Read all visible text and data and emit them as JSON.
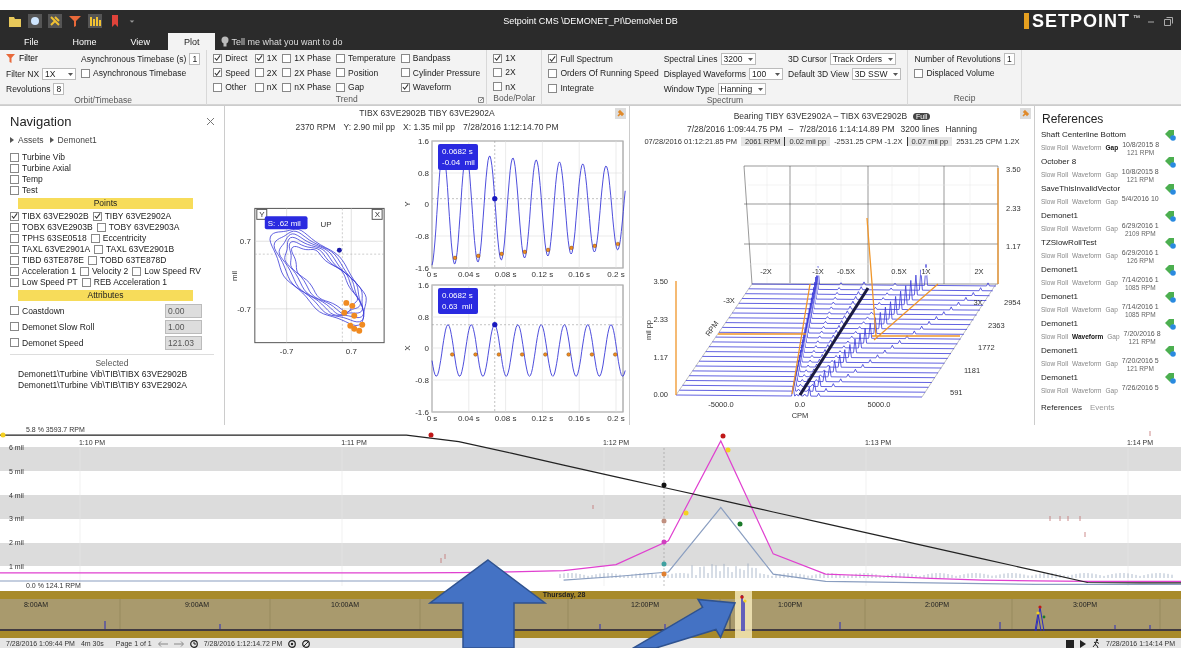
{
  "window": {
    "title": "Setpoint CMS \\DEMONET_PI\\DemoNet DB",
    "logo": "SETPOINT",
    "logo_mark": "™"
  },
  "ribbon_tabs": [
    {
      "label": "File",
      "selected": false
    },
    {
      "label": "Home",
      "selected": false
    },
    {
      "label": "View",
      "selected": false
    },
    {
      "label": "Plot",
      "selected": true
    }
  ],
  "tell_me": {
    "placeholder": "Tell me what you want to do"
  },
  "ribbon_groups": [
    {
      "title": "Orbit/Timebase",
      "launcher": false,
      "rows": [
        [
          {
            "kind": "filter",
            "label": "Filter"
          },
          {
            "kind": "number",
            "label": "Asynchronous Timebase (s)",
            "value": "1"
          }
        ],
        [
          {
            "kind": "dropdown",
            "label": "Filter NX",
            "value": "1X"
          },
          {
            "kind": "checkbox",
            "label": "Asynchronous Timebase",
            "checked": false
          }
        ],
        [
          {
            "kind": "number",
            "label": "Revolutions",
            "value": "8"
          }
        ]
      ]
    },
    {
      "title": "Trend",
      "launcher": true,
      "rows": [
        [
          {
            "kind": "checkbox",
            "label": "Direct",
            "checked": true
          },
          {
            "kind": "checkbox",
            "label": "1X",
            "checked": true
          },
          {
            "kind": "checkbox",
            "label": "1X Phase",
            "checked": false
          },
          {
            "kind": "checkbox",
            "label": "Temperature",
            "checked": false
          },
          {
            "kind": "checkbox",
            "label": "Bandpass",
            "checked": false
          }
        ],
        [
          {
            "kind": "checkbox",
            "label": "Speed",
            "checked": true
          },
          {
            "kind": "checkbox",
            "label": "2X",
            "checked": false
          },
          {
            "kind": "checkbox",
            "label": "2X Phase",
            "checked": false
          },
          {
            "kind": "checkbox",
            "label": "Position",
            "checked": false
          },
          {
            "kind": "checkbox",
            "label": "Cylinder Pressure",
            "checked": false
          }
        ],
        [
          {
            "kind": "checkbox",
            "label": "Other",
            "checked": false
          },
          {
            "kind": "checkbox",
            "label": "nX",
            "checked": false
          },
          {
            "kind": "checkbox",
            "label": "nX Phase",
            "checked": false
          },
          {
            "kind": "checkbox",
            "label": "Gap",
            "checked": false
          },
          {
            "kind": "checkbox",
            "label": "Waveform",
            "checked": true
          }
        ]
      ]
    },
    {
      "title": "Bode/Polar",
      "launcher": false,
      "rows": [
        [
          {
            "kind": "checkbox",
            "label": "1X",
            "checked": true
          }
        ],
        [
          {
            "kind": "checkbox",
            "label": "2X",
            "checked": false
          }
        ],
        [
          {
            "kind": "checkbox",
            "label": "nX",
            "checked": false
          }
        ]
      ]
    },
    {
      "title": "Spectrum",
      "launcher": false,
      "rows": [
        [
          {
            "kind": "checkbox",
            "label": "Full Spectrum",
            "checked": true
          },
          {
            "kind": "dropdown",
            "label": "Spectral Lines",
            "value": "3200"
          },
          {
            "kind": "dropdown",
            "label": "3D Cursor",
            "value": "Track Orders"
          }
        ],
        [
          {
            "kind": "checkbox",
            "label": "Orders Of Running Speed",
            "checked": false
          },
          {
            "kind": "dropdown",
            "label": "Displayed Waveforms",
            "value": "100"
          },
          {
            "kind": "dropdown",
            "label": "Default 3D View",
            "value": "3D SSW"
          }
        ],
        [
          {
            "kind": "checkbox",
            "label": "Integrate",
            "checked": false
          },
          {
            "kind": "dropdown",
            "label": "Window Type",
            "value": "Hanning"
          }
        ]
      ]
    },
    {
      "title": "Recip",
      "launcher": false,
      "rows": [
        [
          {
            "kind": "number",
            "label": "Number of Revolutions",
            "value": "1"
          }
        ],
        [
          {
            "kind": "checkbox",
            "label": "Displaced Volume",
            "checked": false
          }
        ]
      ]
    }
  ],
  "navigation": {
    "title": "Navigation",
    "breadcrumb": [
      "Assets",
      "Demonet1"
    ],
    "groups": [
      {
        "label": "Turbine Vib",
        "checked": false
      },
      {
        "label": "Turbine Axial",
        "checked": false
      },
      {
        "label": "Temp",
        "checked": false
      },
      {
        "label": "Test",
        "checked": false
      }
    ],
    "points_header": "Points",
    "points": [
      {
        "label": "TIBX 63VE2902B",
        "checked": true
      },
      {
        "label": "TIBY 63VE2902A",
        "checked": true
      },
      {
        "label": "TOBX 63VE2903B",
        "checked": false
      },
      {
        "label": "TOBY 63VE2903A",
        "checked": false
      },
      {
        "label": "TPHS 63SE0518",
        "checked": false
      },
      {
        "label": "Eccentricity",
        "checked": false
      },
      {
        "label": "TAXL 63VE2901A",
        "checked": false
      },
      {
        "label": "TAXL 63VE2901B",
        "checked": false
      },
      {
        "label": "TIBD 63TE878E",
        "checked": false
      },
      {
        "label": "TOBD 63TE878D",
        "checked": false
      },
      {
        "label": "Acceleration 1",
        "checked": false
      },
      {
        "label": "Velocity 2",
        "checked": false
      },
      {
        "label": "Low Speed RV",
        "checked": false
      },
      {
        "label": "Low Speed PT",
        "checked": false
      },
      {
        "label": "REB Acceleration 1",
        "checked": false
      }
    ],
    "attributes_header": "Attributes",
    "attributes": [
      {
        "label": "Coastdown",
        "checked": false,
        "value": "0.00"
      },
      {
        "label": "Demonet Slow Roll",
        "checked": false,
        "value": "1.00"
      },
      {
        "label": "Demonet Speed",
        "checked": false,
        "value": "121.03"
      }
    ],
    "selected_header": "Selected",
    "selected_paths": [
      "Demonet1\\Turbine Vib\\TIB\\TIBX 63VE2902B",
      "Demonet1\\Turbine Vib\\TIB\\TIBY 63VE2902A"
    ]
  },
  "orbit_panel": {
    "title": "TIBX 63VE2902B TIBY 63VE2902A",
    "readings": [
      "2370 RPM",
      "Y: 2.90 mil pp",
      "X: 1.35 mil pp",
      "7/28/2016 1:12:14.70 PM"
    ],
    "orbit": {
      "y_box": "Y",
      "x_box": "X",
      "tooltip": "S: .62 mil",
      "direction": "UP",
      "ylabel": "mil",
      "y_ticks": [
        "0.7",
        "-0.7"
      ],
      "x_ticks": [
        "-0.7",
        "0.7"
      ]
    },
    "waveforms": [
      {
        "axis": "Y",
        "tooltip": [
          "0.0682 s",
          "-0.04  mil"
        ],
        "y_ticks": [
          "1.6",
          "0.8",
          "0",
          "-0.8",
          "-1.6"
        ],
        "x_ticks": [
          "0 s",
          "0.04 s",
          "0.08 s",
          "0.12 s",
          "0.16 s",
          "0.2 s"
        ]
      },
      {
        "axis": "X",
        "tooltip": [
          "0.0682 s",
          "0.63  mil"
        ],
        "y_ticks": [
          "1.6",
          "0.8",
          "0",
          "-0.8",
          "-1.6"
        ],
        "x_ticks": [
          "0 s",
          "0.04 s",
          "0.08 s",
          "0.12 s",
          "0.16 s",
          "0.2 s"
        ]
      }
    ]
  },
  "waterfall": {
    "title": "Bearing TIBY 63VE2902A – TIBX 63VE2902B",
    "badge": "Full",
    "info": [
      "7/28/2016 1:09:44.75 PM",
      "–",
      "7/28/2016 1:14:14.89 PM",
      "3200 lines",
      "Hanning"
    ],
    "cursor": [
      {
        "text": "07/28/2016 01:12:21.85 PM",
        "shaded": false
      },
      {
        "text": "2061 RPM",
        "shaded": true
      },
      {
        "text": "0.02 mil pp",
        "shaded": true
      },
      {
        "text": "-2531.25 CPM -1.2X",
        "shaded": false
      },
      {
        "text": "0.07 mil pp",
        "shaded": true
      },
      {
        "text": "2531.25 CPM 1.2X",
        "shaded": false
      }
    ],
    "back_ticks": [
      "3.50",
      "2.33",
      "1.17"
    ],
    "left_ticks": [
      "3.50",
      "2.33",
      "1.17",
      "0.00"
    ],
    "orders": [
      "-2X",
      "-1X",
      "-0.5X",
      "0.5X",
      "1X",
      "2X"
    ],
    "side_orders": [
      "-3X",
      "3X"
    ],
    "rpm_ticks": [
      "2954",
      "2363",
      "1772",
      "1181",
      "591"
    ],
    "cpm_ticks": [
      "-5000.0",
      "0.0",
      "5000.0"
    ],
    "zlabel": "mil pp",
    "ylabel": "RPM",
    "xlabel": "CPM"
  },
  "references": {
    "title": "References",
    "items": [
      {
        "name": "Shaft Centerline Bottom",
        "tags": [
          {
            "label": "Slow Roll",
            "selected": false
          },
          {
            "label": "Waveform",
            "selected": false
          },
          {
            "label": "Gap",
            "selected": true
          }
        ],
        "date": "10/8/2015 8",
        "rpm": "121 RPM"
      },
      {
        "name": "October 8",
        "tags": [
          {
            "label": "Slow Roll",
            "selected": false
          },
          {
            "label": "Waveform",
            "selected": false
          },
          {
            "label": "Gap",
            "selected": false
          }
        ],
        "date": "10/8/2015 8",
        "rpm": "121 RPM"
      },
      {
        "name": "SaveThisInvalidVector",
        "tags": [
          {
            "label": "Slow Roll",
            "selected": false
          },
          {
            "label": "Waveform",
            "selected": false
          },
          {
            "label": "Gap",
            "selected": false
          }
        ],
        "date": "5/4/2016 10"
      },
      {
        "name": "Demonet1",
        "tags": [
          {
            "label": "Slow Roll",
            "selected": false
          },
          {
            "label": "Waveform",
            "selected": false
          },
          {
            "label": "Gap",
            "selected": false
          }
        ],
        "date": "6/29/2016 1",
        "rpm": "2109 RPM"
      },
      {
        "name": "TZSlowRollTest",
        "tags": [
          {
            "label": "Slow Roll",
            "selected": false
          },
          {
            "label": "Waveform",
            "selected": false
          },
          {
            "label": "Gap",
            "selected": false
          }
        ],
        "date": "6/29/2016 1",
        "rpm": "126 RPM"
      },
      {
        "name": "Demonet1",
        "tags": [
          {
            "label": "Slow Roll",
            "selected": false
          },
          {
            "label": "Waveform",
            "selected": false
          },
          {
            "label": "Gap",
            "selected": false
          }
        ],
        "date": "7/14/2016 1",
        "rpm": "1085 RPM"
      },
      {
        "name": "Demonet1",
        "tags": [
          {
            "label": "Slow Roll",
            "selected": false
          },
          {
            "label": "Waveform",
            "selected": false
          },
          {
            "label": "Gap",
            "selected": false
          }
        ],
        "date": "7/14/2016 1",
        "rpm": "1085 RPM"
      },
      {
        "name": "Demonet1",
        "tags": [
          {
            "label": "Slow Roll",
            "selected": false
          },
          {
            "label": "Waveform",
            "selected": true
          },
          {
            "label": "Gap",
            "selected": false
          }
        ],
        "date": "7/20/2016 8",
        "rpm": "121 RPM"
      },
      {
        "name": "Demonet1",
        "tags": [
          {
            "label": "Slow Roll",
            "selected": false
          },
          {
            "label": "Waveform",
            "selected": false
          },
          {
            "label": "Gap",
            "selected": false
          }
        ],
        "date": "7/20/2016 5",
        "rpm": "121 RPM"
      },
      {
        "name": "Demonet1",
        "tags": [
          {
            "label": "Slow Roll",
            "selected": false
          },
          {
            "label": "Waveform",
            "selected": false
          },
          {
            "label": "Gap",
            "selected": false
          }
        ],
        "date": "7/26/2016 5"
      }
    ],
    "tabs": [
      {
        "label": "References",
        "selected": true
      },
      {
        "label": "Events",
        "selected": false
      }
    ]
  },
  "trend": {
    "top_reading": "5.8 % 3593.7 RPM",
    "bottom_reading": "0.0 % 124.1 RPM",
    "chart_data": {
      "type": "line",
      "categories": [
        null,
        null,
        "1:10 PM",
        null,
        null,
        null,
        null,
        "1:11 PM",
        null,
        null,
        null,
        null,
        "1:12 PM",
        null,
        null,
        null,
        null,
        "1:13 PM",
        null,
        null,
        null,
        null,
        "1:14 PM",
        null
      ],
      "series": [
        {
          "color": "#e040d0",
          "values": [
            0.75,
            0.75,
            0.75,
            0.75,
            0.75,
            0.75,
            0.75,
            0.75,
            0.75,
            0.76,
            0.8,
            0.85,
            1.1,
            2.1,
            6.3,
            1.55,
            0.7,
            0.62,
            0.52,
            0.45,
            0.42,
            0.4,
            0.4,
            0.4
          ]
        },
        {
          "color": "#8a9ec0",
          "values": [
            0.41,
            0.41,
            0.41,
            0.41,
            0.41,
            0.41,
            0.41,
            0.41,
            0.41,
            0.41,
            null,
            0.45,
            0.6,
            0.79,
            3.5,
            0.7,
            0.4,
            0.36,
            0.33,
            0.3,
            0.27,
            0.27,
            0.27,
            0.27
          ]
        },
        {
          "color": "#222222",
          "values": [
            6.54,
            6.54,
            6.54,
            6.54,
            6.54,
            6.54,
            6.54,
            6.54,
            6.54,
            6.27,
            5.78,
            5.28,
            4.79,
            4.3,
            3.81,
            3.31,
            2.82,
            2.33,
            1.83,
            1.34,
            0.85,
            0.35,
            0.33,
            0.33
          ]
        }
      ],
      "ylim": [
        0,
        6.92
      ],
      "yticks": [
        {
          "value": 6,
          "label": "6 mil"
        },
        {
          "value": 5,
          "label": "5 mil"
        },
        {
          "value": 4,
          "label": "4 mil"
        },
        {
          "value": 3,
          "label": "3 mil"
        },
        {
          "value": 2,
          "label": "2 mil"
        },
        {
          "value": 1,
          "label": "1 mil"
        }
      ]
    }
  },
  "timeline": {
    "day": "Thursday, 28",
    "hours": [
      "8:00AM",
      "9:00AM",
      "10:00AM",
      "12:00PM",
      "1:00PM",
      "2:00PM",
      "3:00PM"
    ]
  },
  "status_bar": {
    "start": "7/28/2016 1:09:44 PM",
    "duration": "4m 30s",
    "page": "Page 1 of 1",
    "cursor_time": "7/28/2016 1:12:14.72 PM",
    "end_time": "7/28/2016 1:14:14 PM"
  },
  "overlay_arrows": [
    {
      "kind": "up"
    },
    {
      "kind": "diagonal"
    }
  ]
}
